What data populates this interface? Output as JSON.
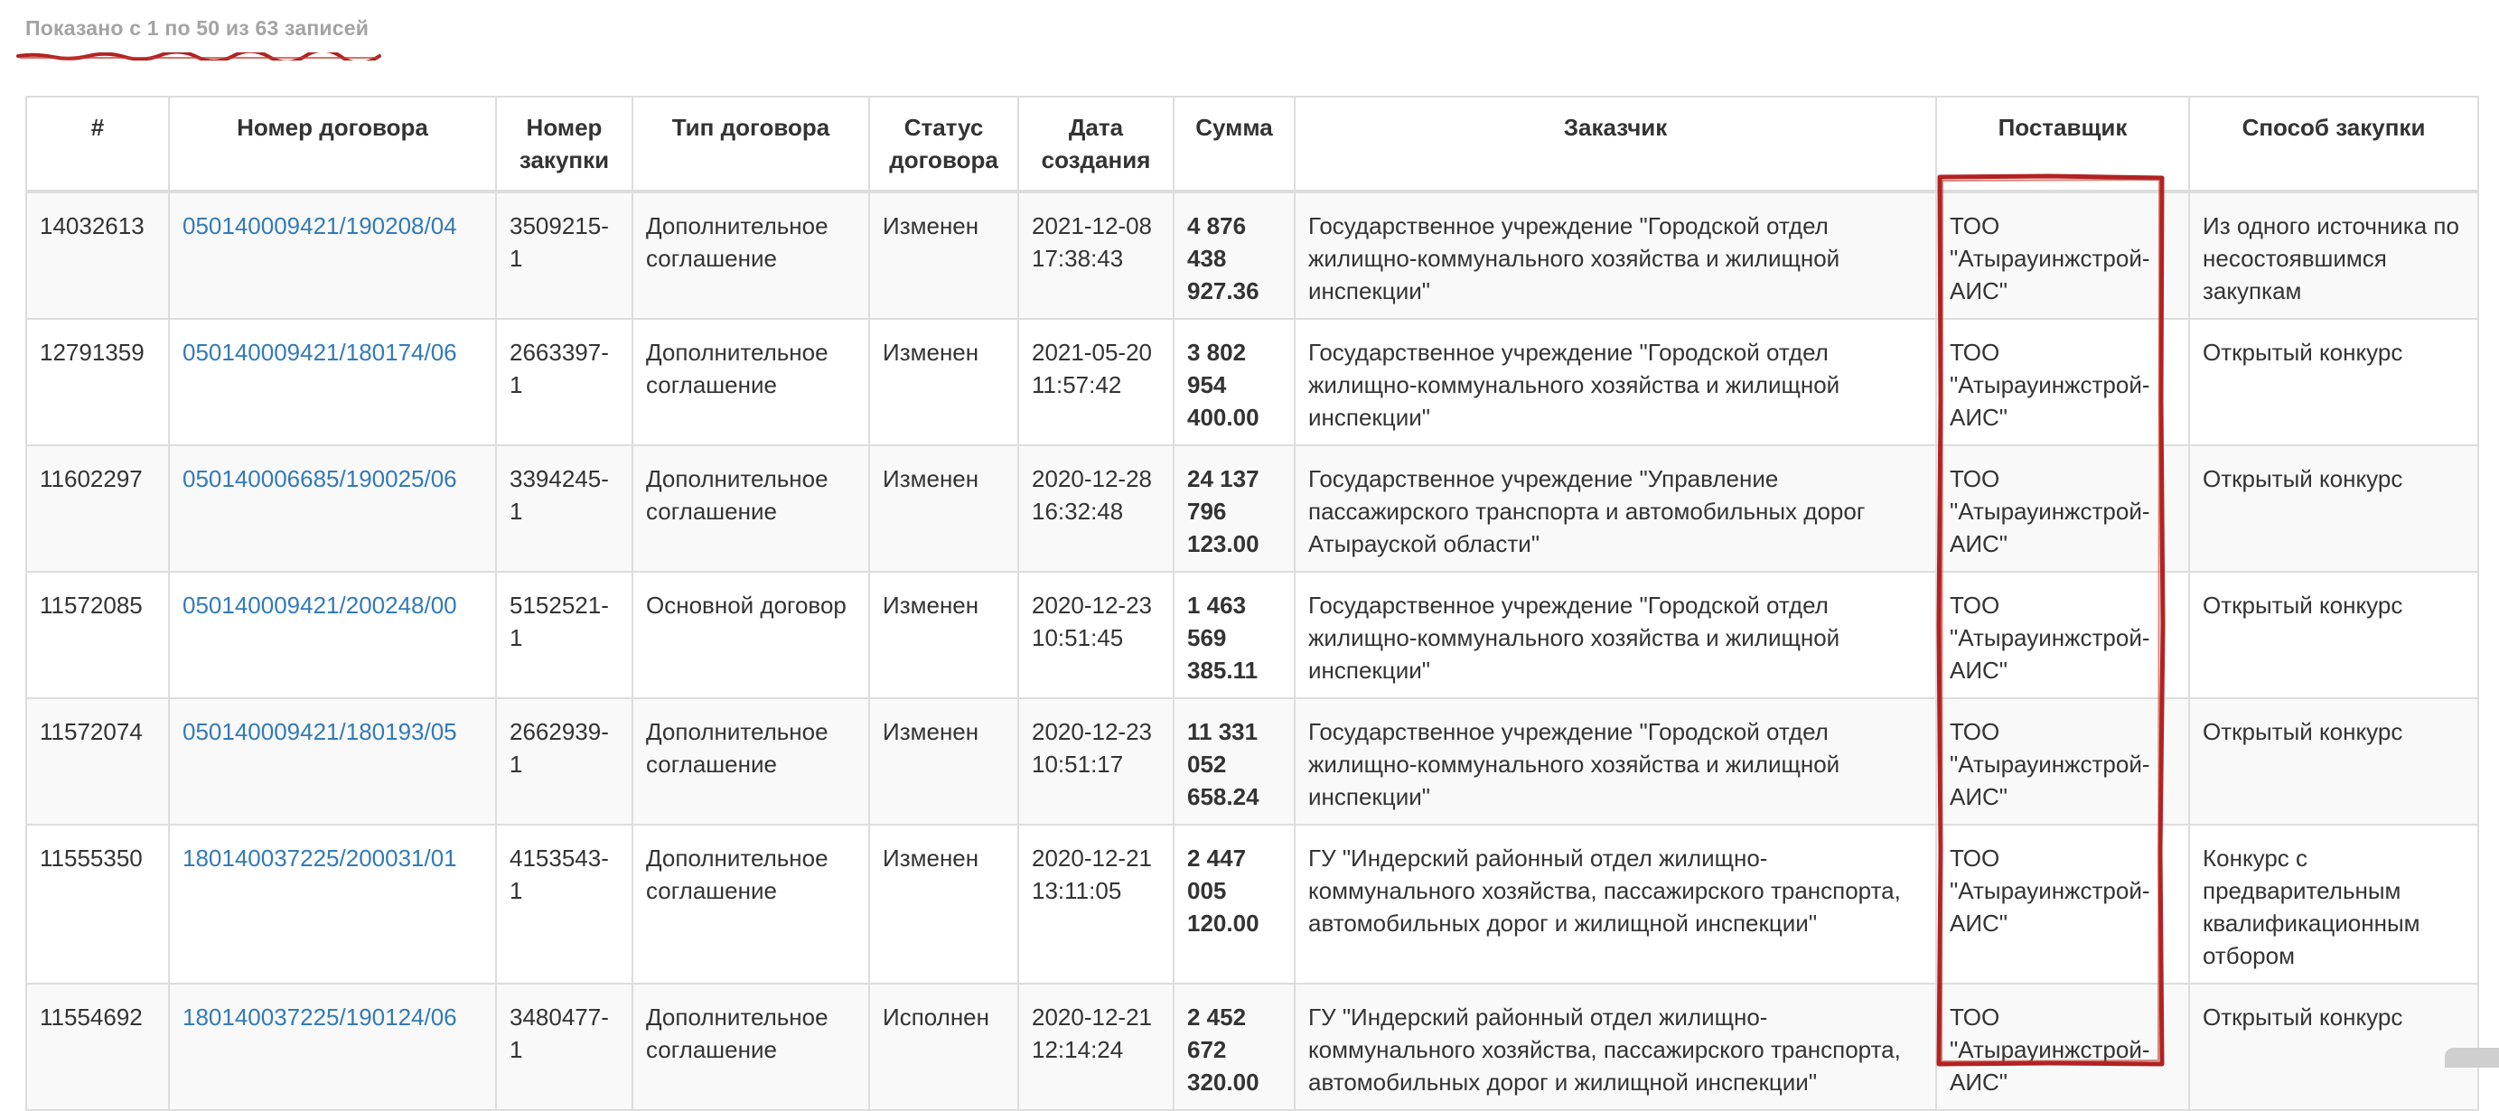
{
  "summary": {
    "text": "Показано с 1 по 50 из 63 записей"
  },
  "annotation_color": "#b22222",
  "link_color": "#337ab7",
  "table": {
    "headers": {
      "id": "#",
      "contract_number": "Номер договора",
      "purchase_number": "Номер закупки",
      "contract_type": "Тип договора",
      "contract_status": "Статус договора",
      "created_date": "Дата создания",
      "amount": "Сумма",
      "customer": "Заказчик",
      "supplier": "Поставщик",
      "procurement_method": "Способ закупки"
    },
    "rows": [
      {
        "id": "14032613",
        "contract_number": "050140009421/190208/04",
        "purchase_number": "3509215-1",
        "contract_type": "Дополнительное соглашение",
        "contract_status": "Изменен",
        "created_date": "2021-12-08 17:38:43",
        "amount": "4 876 438 927.36",
        "customer": "Государственное учреждение \"Городской отдел жилищно-коммунального хозяйства и жилищной инспекции\"",
        "supplier": "ТОО \"Атырауинжстрой-АИС\"",
        "procurement_method": "Из одного источника по несостоявшимся закупкам"
      },
      {
        "id": "12791359",
        "contract_number": "050140009421/180174/06",
        "purchase_number": "2663397-1",
        "contract_type": "Дополнительное соглашение",
        "contract_status": "Изменен",
        "created_date": "2021-05-20 11:57:42",
        "amount": "3 802 954 400.00",
        "customer": "Государственное учреждение \"Городской отдел жилищно-коммунального хозяйства и жилищной инспекции\"",
        "supplier": "ТОО \"Атырауинжстрой-АИС\"",
        "procurement_method": "Открытый конкурс"
      },
      {
        "id": "11602297",
        "contract_number": "050140006685/190025/06",
        "purchase_number": "3394245-1",
        "contract_type": "Дополнительное соглашение",
        "contract_status": "Изменен",
        "created_date": "2020-12-28 16:32:48",
        "amount": "24 137 796 123.00",
        "customer": "Государственное учреждение \"Управление пассажирского транспорта и автомобильных дорог Атырауской области\"",
        "supplier": "ТОО \"Атырауинжстрой-АИС\"",
        "procurement_method": "Открытый конкурс"
      },
      {
        "id": "11572085",
        "contract_number": "050140009421/200248/00",
        "purchase_number": "5152521-1",
        "contract_type": "Основной договор",
        "contract_status": "Изменен",
        "created_date": "2020-12-23 10:51:45",
        "amount": "1 463 569 385.11",
        "customer": "Государственное учреждение \"Городской отдел жилищно-коммунального хозяйства и жилищной инспекции\"",
        "supplier": "ТОО \"Атырауинжстрой-АИС\"",
        "procurement_method": "Открытый конкурс"
      },
      {
        "id": "11572074",
        "contract_number": "050140009421/180193/05",
        "purchase_number": "2662939-1",
        "contract_type": "Дополнительное соглашение",
        "contract_status": "Изменен",
        "created_date": "2020-12-23 10:51:17",
        "amount": "11 331 052 658.24",
        "customer": "Государственное учреждение \"Городской отдел жилищно-коммунального хозяйства и жилищной инспекции\"",
        "supplier": "ТОО \"Атырауинжстрой-АИС\"",
        "procurement_method": "Открытый конкурс"
      },
      {
        "id": "11555350",
        "contract_number": "180140037225/200031/01",
        "purchase_number": "4153543-1",
        "contract_type": "Дополнительное соглашение",
        "contract_status": "Изменен",
        "created_date": "2020-12-21 13:11:05",
        "amount": "2 447 005 120.00",
        "customer": "ГУ \"Индерский районный отдел жилищно-коммунального хозяйства, пассажирского транспорта, автомобильных дорог и жилищной инспекции\"",
        "supplier": "ТОО \"Атырауинжстрой-АИС\"",
        "procurement_method": "Конкурс с предварительным квалификационным отбором"
      },
      {
        "id": "11554692",
        "contract_number": "180140037225/190124/06",
        "purchase_number": "3480477-1",
        "contract_type": "Дополнительное соглашение",
        "contract_status": "Исполнен",
        "created_date": "2020-12-21 12:14:24",
        "amount": "2 452 672 320.00",
        "customer": "ГУ \"Индерский районный отдел жилищно-коммунального хозяйства, пассажирского транспорта, автомобильных дорог и жилищной инспекции\"",
        "supplier": "ТОО \"Атырауинжстрой-АИС\"",
        "procurement_method": "Открытый конкурс"
      }
    ]
  }
}
